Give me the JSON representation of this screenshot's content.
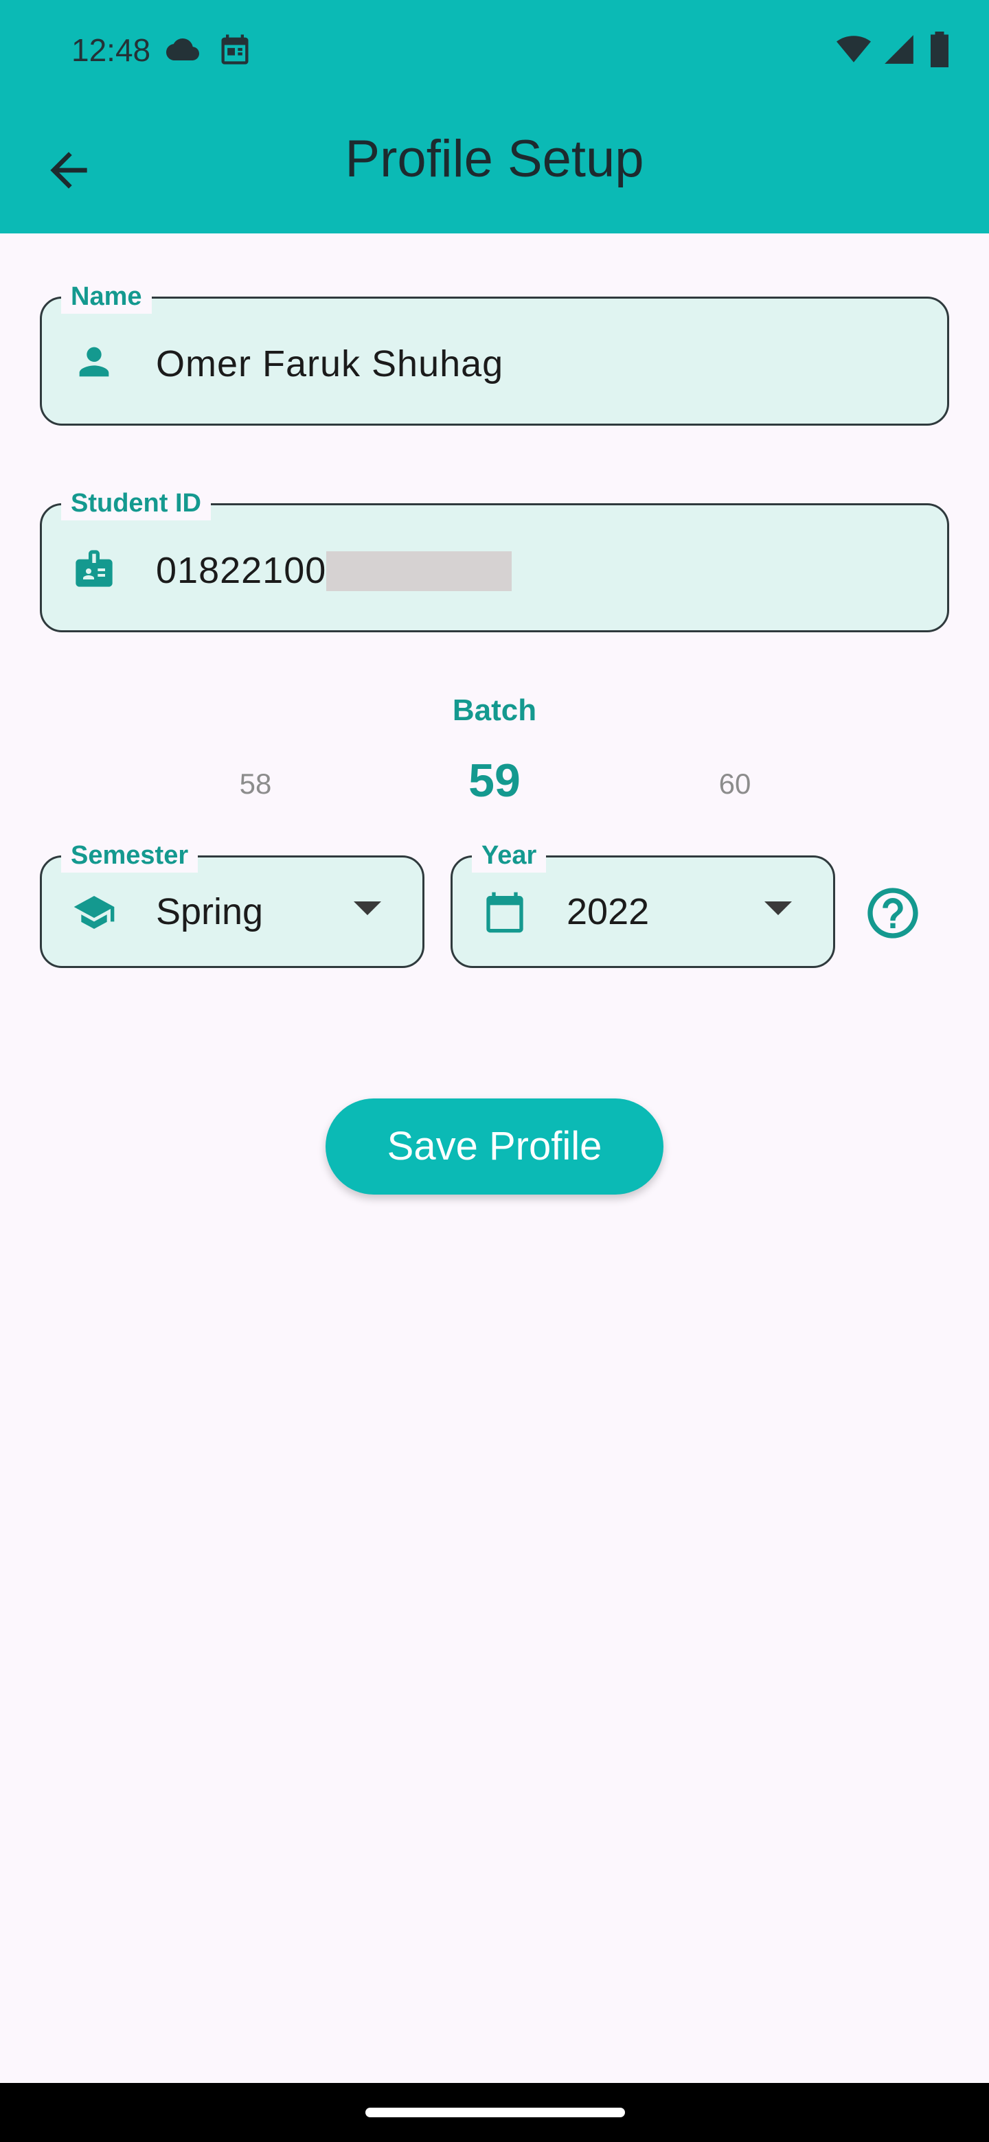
{
  "status_bar": {
    "time": "12:48",
    "left_icons": [
      "cloud-icon",
      "calendar-notification-icon"
    ],
    "right_icons": [
      "wifi-icon",
      "signal-icon",
      "battery-icon"
    ]
  },
  "app_bar": {
    "title": "Profile Setup",
    "back_icon": "arrow-back-icon",
    "color": "#0bbab5"
  },
  "form": {
    "name": {
      "label": "Name",
      "value": "Omer Faruk Shuhag",
      "icon": "person-icon"
    },
    "student_id": {
      "label": "Student ID",
      "value": "01822100",
      "icon": "id-badge-icon"
    },
    "batch": {
      "label": "Batch",
      "prev": "58",
      "selected": "59",
      "next": "60"
    },
    "semester": {
      "label": "Semester",
      "value": "Spring",
      "icon": "school-icon"
    },
    "year": {
      "label": "Year",
      "value": "2022",
      "icon": "calendar-icon"
    },
    "help_icon": "help-circle-icon",
    "save_label": "Save Profile"
  },
  "colors": {
    "accent": "#14998f",
    "field_bg": "#e0f4f1",
    "page_bg": "#fcf7fd"
  }
}
